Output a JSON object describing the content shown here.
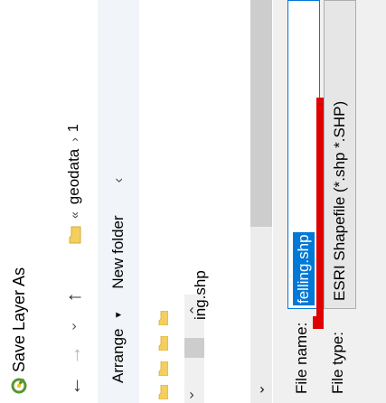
{
  "window": {
    "title": "Save Layer As",
    "app_icon": "qgis-logo-icon"
  },
  "navigation": {
    "back_icon": "arrow-left-icon",
    "forward_icon": "arrow-right-icon",
    "recent_icon": "chevron-down-icon",
    "up_icon": "arrow-up-icon",
    "back_glyph": "←",
    "forward_glyph": "→",
    "recent_glyph": "›",
    "up_glyph": "↑"
  },
  "address": {
    "overflow_glyph": "«",
    "breadcrumbs": [
      "geodata",
      "1"
    ],
    "separator_glyph": "›",
    "folder_icon": "folder-icon"
  },
  "toolbar": {
    "arrange_label": "Arrange",
    "arrange_arrow": "▼",
    "new_folder_label": "New folder",
    "collapse_glyph": "‹"
  },
  "content": {
    "files": [
      "ing.shp"
    ],
    "scroll_left_glyph": "‹",
    "scroll_right_glyph": "›",
    "scroll_down_glyph": "⌄"
  },
  "form": {
    "file_name_label": "File name:",
    "file_name_value": "felling.shp",
    "file_type_label": "File type:",
    "file_type_value": "ESRI Shapefile (*.shp *.SHP)"
  },
  "colors": {
    "selection": "#0078d7",
    "annotation": "#e00000",
    "toolbar_bg": "#f1f4f8",
    "form_bg": "#f0f0f0",
    "logo_green": "#589632",
    "folder_yellow": "#f4cf5d"
  }
}
